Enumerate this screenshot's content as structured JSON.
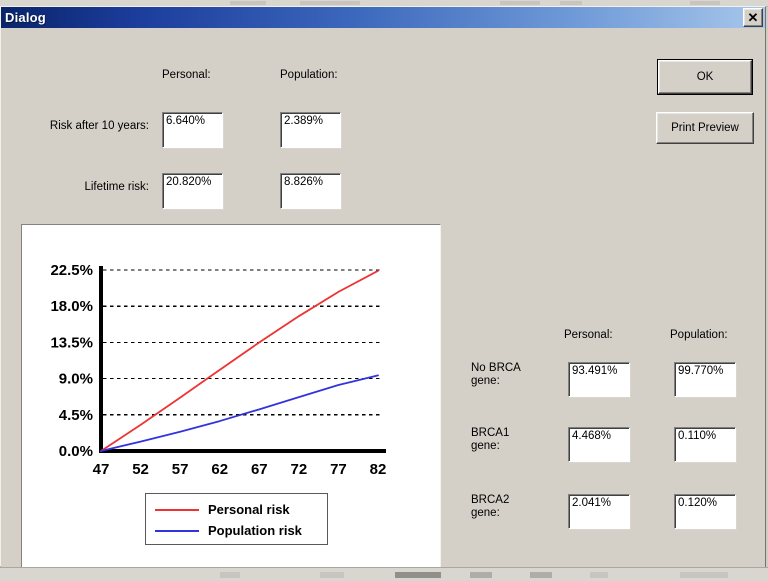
{
  "window": {
    "title": "Dialog",
    "close_label": "✕"
  },
  "buttons": {
    "ok": "OK",
    "print_preview": "Print Preview"
  },
  "risk_section": {
    "col_personal": "Personal:",
    "col_population": "Population:",
    "rows": [
      {
        "label": "Risk after 10 years:",
        "personal": "6.640%",
        "population": "2.389%"
      },
      {
        "label": "Lifetime risk:",
        "personal": "20.820%",
        "population": "8.826%"
      }
    ]
  },
  "gene_section": {
    "col_personal": "Personal:",
    "col_population": "Population:",
    "rows": [
      {
        "label_line1": "No BRCA",
        "label_line2": "gene:",
        "personal": "93.491%",
        "population": "99.770%"
      },
      {
        "label_line1": "BRCA1",
        "label_line2": "gene:",
        "personal": "4.468%",
        "population": "0.110%"
      },
      {
        "label_line1": "BRCA2",
        "label_line2": "gene:",
        "personal": "2.041%",
        "population": "0.120%"
      }
    ]
  },
  "legend": {
    "personal": "Personal risk",
    "population": "Population risk"
  },
  "colors": {
    "personal_risk": "#ee3333",
    "population_risk": "#3333dd",
    "titlebar_start": "#0a246a",
    "titlebar_end": "#a7c6ea",
    "face": "#d4d0c8"
  },
  "chart_data": {
    "type": "line",
    "title": "",
    "xlabel": "",
    "ylabel": "",
    "xlim": [
      47,
      82
    ],
    "ylim": [
      0,
      22.5
    ],
    "grid": true,
    "legend_position": "bottom",
    "x_ticks": [
      47,
      52,
      57,
      62,
      67,
      72,
      77,
      82
    ],
    "y_ticks": [
      0.0,
      4.5,
      9.0,
      13.5,
      18.0,
      22.5
    ],
    "y_tick_labels": [
      "0.0%",
      "4.5%",
      "9.0%",
      "13.5%",
      "18.0%",
      "22.5%"
    ],
    "x_tick_labels": [
      "47",
      "52",
      "57",
      "62",
      "67",
      "72",
      "77",
      "82"
    ],
    "x": [
      47,
      52,
      57,
      62,
      67,
      72,
      77,
      82
    ],
    "series": [
      {
        "name": "Personal risk",
        "color": "#ee3333",
        "values": [
          0.0,
          3.25,
          6.64,
          10.09,
          13.5,
          16.76,
          19.78,
          22.4
        ]
      },
      {
        "name": "Population risk",
        "color": "#3333dd",
        "values": [
          0.0,
          1.17,
          2.39,
          3.72,
          5.18,
          6.7,
          8.2,
          9.4
        ]
      }
    ]
  }
}
